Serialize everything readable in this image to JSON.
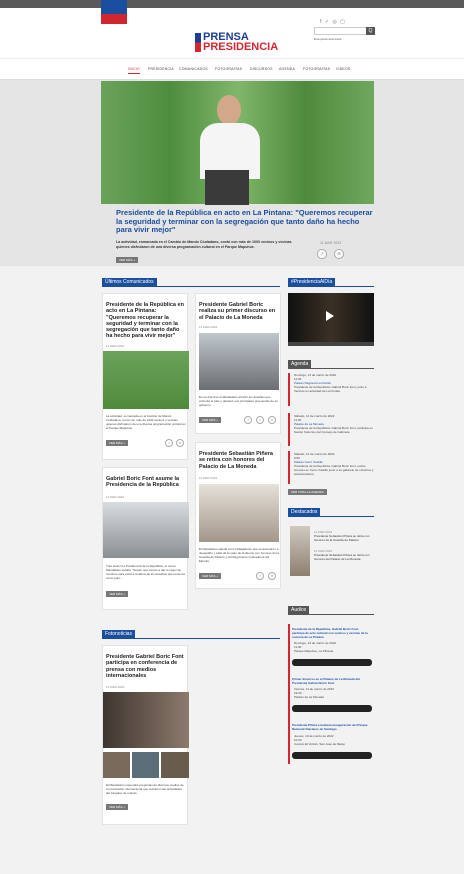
{
  "header": {
    "logo_line1": "PRENSA",
    "logo_line2": "PRESIDENCIA",
    "social": "f ✓ ◎ ▢",
    "search_button": "Q",
    "advanced_search": "Búsqueda avanzada"
  },
  "nav": [
    "INICIO",
    "PRESIDENCIA",
    "COMUNICADOS",
    "FOTOGRAFÍAS",
    "DISCURSOS",
    "AGENDA",
    "FOTOGRAFÍAS",
    "VIDEOS"
  ],
  "hero": {
    "title": "Presidente de la República en acto en La Pintana: \"Queremos recuperar la seguridad y terminar con la segregación que tanto daño ha hecho para vivir mejor\"",
    "lead": "La actividad, enmarcada en el Cambio de Mando Ciudadano, contó con más de 1000 vecinos y vecinas quienes disfrutaron de una diversa programación cultural en el Parque Mapuhue.",
    "date": "11 MAR 2022",
    "button": "VER MÁS +"
  },
  "sections": {
    "comunicados": "Últimos Comunicados",
    "video": "#PresidenciaAlDía",
    "agenda": "Agenda",
    "destacados": "Destacados",
    "audios": "Audios",
    "fotonoticias": "Fotonoticias"
  },
  "cards": [
    {
      "title": "Presidente de la República en acto en La Pintana: \"Queremos recuperar la seguridad y terminar con la segregación que tanto daño ha hecho para vivir mejor\"",
      "date": "11 MAR 2022",
      "text": "La actividad, enmarcada en el Cambio de Mando Ciudadano, contó con más de 1000 vecinos y vecinas quienes disfrutaron de una diversa programación cultural en el Parque Mapuhue.",
      "button": "VER MÁS +"
    },
    {
      "title": "Presidente Gabriel Boric realiza su primer discurso en el Palacio de La Moneda",
      "date": "11 MAR 2022",
      "text": "En su discurso el Mandatario abordó los desafíos que enfrenta el país y destacó sus principales propuestas de su gobierno.",
      "button": "VER MÁS +"
    },
    {
      "title": "Gabriel Boric Font asume la Presidencia de la República",
      "date": "11 MAR 2022",
      "text": "Tras asumir la Presidencia de la República, el nuevo Mandatario señaló: \"Sepan que vamos a dar lo mejor de nosotros para estar a la altura de los desafíos que tenemos como país...",
      "button": "VER MÁS +"
    },
    {
      "title": "Presidente Sebastián Piñera se retira con honores del Palacio de La Moneda",
      "date": "11 MAR 2022",
      "text": "El Mandatario saludó a los trabajadores que se asomaron a despedirlo y salió de la sede de Gobierno con honores de la Guardia de Palacio y del Regimiento Granaderos del Ejército.",
      "button": "VER MÁS +"
    },
    {
      "title": "Presidente Gabriel Boric Font participa en conferencia de prensa con medios internacionales",
      "date": "12 MAR 2022",
      "text": "El Mandatario respondió preguntas de diversos medios de comunicación internacional que cubrieron las actividades del traspaso de mando.",
      "button": "VER MÁS +"
    }
  ],
  "agenda": [
    {
      "date": "Domingo, 13 de marzo de 2022",
      "time": "11:00",
      "place": "Palacio Regional La Florida",
      "desc": "Presidente de la República, Gabriel Boric Font, junto a Vecinos en actividad de La Florida."
    },
    {
      "date": "Sábado, 12 de marzo de 2022",
      "time": "11:00",
      "place": "Palacio de La Moneda",
      "desc": "Presidente de la República, Gabriel Boric Font, participa en Sesión Solemne del Consejo de Gabinete."
    },
    {
      "date": "Sábado, 12 de marzo de 2022",
      "time": "9:00",
      "place": "Palacio Cerro Castillo",
      "desc": "Presidente de la República, Gabriel Boric Font, recibe honores en Cerro Castillo junto a su gabinete de ministros y subsecretarios."
    }
  ],
  "agenda_button": "VER TODA LA AGENDA",
  "destacados": [
    {
      "date": "11 MAR 2022",
      "text": "Presidente Sebastián Piñera se retira con honores de la Guardia de Palacio"
    },
    {
      "date": "11 MAR 2022",
      "text": "Presidente Sebastián Piñera se retira con honores del Palacio de La Moneda"
    }
  ],
  "audios": [
    {
      "title": "Presidente de la República, Gabriel Boric Font, participa de acto cultural con vecinos y vecinas de la comuna de La Pintana",
      "date": "Domingo, 13 de marzo de 2022",
      "time": "11:00",
      "place": "Parque Mapuhue, La Pintana",
      "player": "0:00"
    },
    {
      "title": "Primer discurso en el Palacio de La Moneda del Presidente Gabriel Boric Font",
      "date": "Viernes, 11 de marzo de 2022",
      "time": "19:00",
      "place": "Palacio de La Moneda",
      "player": "0:00"
    },
    {
      "title": "Presidente Piñera encabeza inauguración del Parque Nacional Glaciares de Santiago",
      "date": "Jueves, 10 de marzo de 2022",
      "time": "10:00",
      "place": "Camino El Volcán, San José de Maipo",
      "player": "0:00"
    }
  ]
}
